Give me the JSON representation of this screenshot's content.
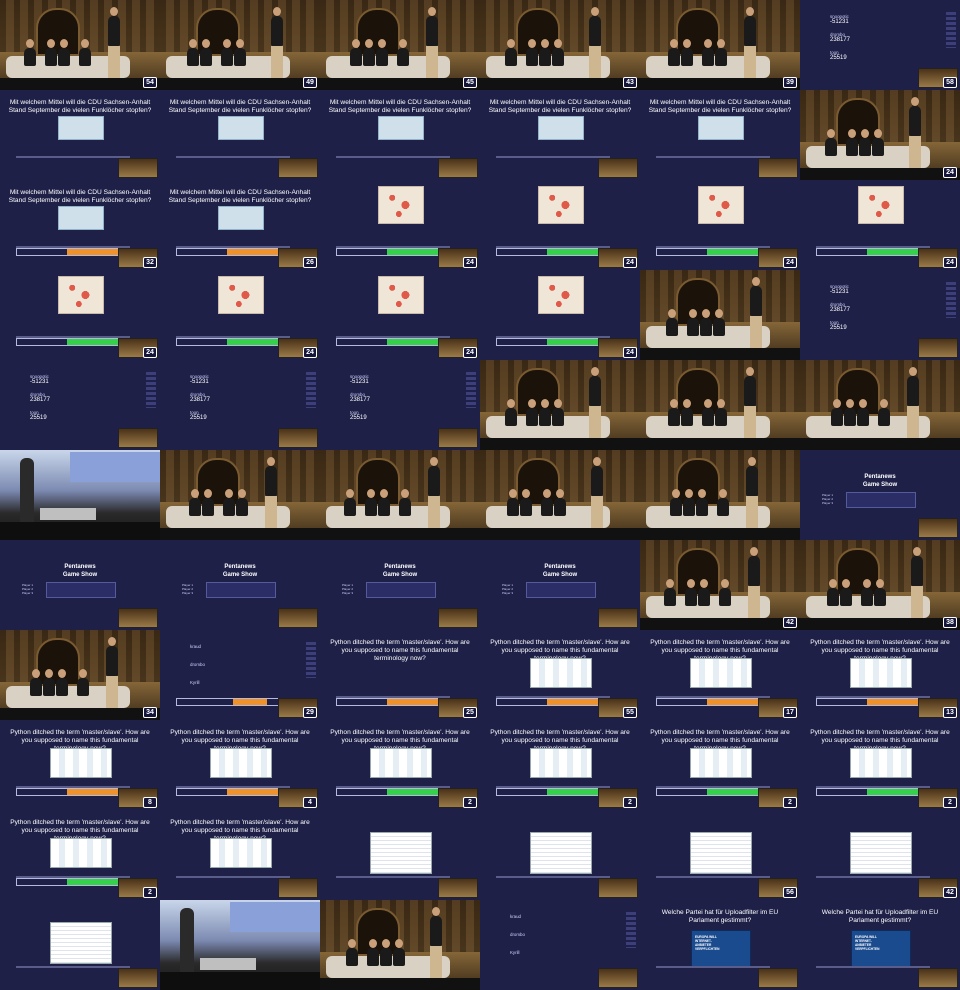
{
  "question_de": "Mit welchem Mittel will die CDU Sachsen-Anhalt Stand September die vielen Funklöcher stopfen?",
  "question_py": "Python ditched the term 'master/slave'. How are you supposed to name this fundamental terminology now?",
  "question_eu": "Welche Partei hat für Uploadfilter im EU Parlament gestimmt?",
  "pentanews_title_1": "Pentanews",
  "pentanews_title_2": "Game Show",
  "players": [
    "Player 1",
    "Player 2",
    "Player 3"
  ],
  "scores_a": [
    {
      "name": "snoopotic",
      "value": "-51231"
    },
    {
      "name": "drombo",
      "value": "238177"
    },
    {
      "name": "toon",
      "value": "25519"
    }
  ],
  "scores_b": [
    {
      "name": "kraud",
      "value": ""
    },
    {
      "name": "drombo",
      "value": ""
    },
    {
      "name": "Kyrill",
      "value": ""
    }
  ],
  "colors": {
    "background": "#1c1d3d",
    "orange": "#f0922a",
    "green": "#35d14a",
    "white": "#ffffff"
  },
  "tiles": [
    {
      "type": "stage",
      "num": "54"
    },
    {
      "type": "stage",
      "num": "49"
    },
    {
      "type": "stage",
      "num": "45"
    },
    {
      "type": "stage",
      "num": "43"
    },
    {
      "type": "stage",
      "num": "39"
    },
    {
      "type": "scores_small",
      "num": "58"
    },
    {
      "type": "slide",
      "q": "de",
      "img": "pic",
      "num": ""
    },
    {
      "type": "slide",
      "q": "de",
      "img": "pic",
      "num": ""
    },
    {
      "type": "slide",
      "q": "de",
      "img": "pic",
      "num": ""
    },
    {
      "type": "slide",
      "q": "de",
      "img": "pic",
      "num": ""
    },
    {
      "type": "slide",
      "q": "de",
      "img": "pic",
      "num": ""
    },
    {
      "type": "stage",
      "num": "24"
    },
    {
      "type": "slide",
      "q": "de",
      "img": "pic",
      "bar": "orange",
      "num": "32"
    },
    {
      "type": "slide",
      "q": "de",
      "img": "pic",
      "bar": "orange",
      "num": "26"
    },
    {
      "type": "slide",
      "q": "",
      "img": "map",
      "bar": "green",
      "num": "24"
    },
    {
      "type": "slide",
      "q": "",
      "img": "map",
      "bar": "green",
      "num": "24"
    },
    {
      "type": "slide",
      "q": "",
      "img": "map",
      "bar": "green",
      "num": "24"
    },
    {
      "type": "slide",
      "q": "",
      "img": "map",
      "bar": "green",
      "num": "24"
    },
    {
      "type": "slide",
      "q": "",
      "img": "map",
      "bar": "green",
      "num": "24"
    },
    {
      "type": "slide",
      "q": "",
      "img": "map",
      "bar": "green",
      "num": "24"
    },
    {
      "type": "slide",
      "q": "",
      "img": "map",
      "bar": "green",
      "num": "24"
    },
    {
      "type": "slide",
      "q": "",
      "img": "map",
      "bar": "green",
      "num": "24"
    },
    {
      "type": "stage",
      "num": ""
    },
    {
      "type": "scores",
      "num": ""
    },
    {
      "type": "scores",
      "num": ""
    },
    {
      "type": "scores",
      "num": ""
    },
    {
      "type": "scores",
      "num": ""
    },
    {
      "type": "stage",
      "num": ""
    },
    {
      "type": "stage",
      "num": ""
    },
    {
      "type": "stage",
      "num": ""
    },
    {
      "type": "hall",
      "num": ""
    },
    {
      "type": "stage",
      "num": ""
    },
    {
      "type": "stage",
      "num": ""
    },
    {
      "type": "stage",
      "num": ""
    },
    {
      "type": "stage",
      "num": ""
    },
    {
      "type": "penta",
      "num": ""
    },
    {
      "type": "penta",
      "num": ""
    },
    {
      "type": "penta",
      "num": ""
    },
    {
      "type": "penta",
      "num": ""
    },
    {
      "type": "penta",
      "num": ""
    },
    {
      "type": "stage",
      "num": "42"
    },
    {
      "type": "stage",
      "num": "38"
    },
    {
      "type": "stage",
      "num": "34"
    },
    {
      "type": "scores_b",
      "bar": "orange",
      "num": "29"
    },
    {
      "type": "slide",
      "q": "py",
      "img": "",
      "bar": "orange",
      "num": "25"
    },
    {
      "type": "slide",
      "q": "py",
      "img": "diag",
      "bar": "orange",
      "num": "55"
    },
    {
      "type": "slide",
      "q": "py",
      "img": "diag",
      "bar": "orange",
      "num": "17"
    },
    {
      "type": "slide",
      "q": "py",
      "img": "diag",
      "bar": "orange",
      "num": "13"
    },
    {
      "type": "slide",
      "q": "py",
      "img": "diag",
      "bar": "orange",
      "num": "8"
    },
    {
      "type": "slide",
      "q": "py",
      "img": "diag",
      "bar": "orange",
      "num": "4"
    },
    {
      "type": "slide",
      "q": "py",
      "img": "diag",
      "bar": "green",
      "num": "2"
    },
    {
      "type": "slide",
      "q": "py",
      "img": "diag",
      "bar": "green",
      "num": "2"
    },
    {
      "type": "slide",
      "q": "py",
      "img": "diag",
      "bar": "green",
      "num": "2"
    },
    {
      "type": "slide",
      "q": "py",
      "img": "diag",
      "bar": "green",
      "num": "2"
    },
    {
      "type": "slide",
      "q": "py",
      "img": "diag",
      "bar": "green",
      "num": "2"
    },
    {
      "type": "slide",
      "q": "py",
      "img": "diag",
      "bar": "",
      "num": ""
    },
    {
      "type": "slide",
      "q": "",
      "img": "doc",
      "bar": "",
      "num": ""
    },
    {
      "type": "slide",
      "q": "",
      "img": "doc",
      "bar": "",
      "num": ""
    },
    {
      "type": "slide",
      "q": "",
      "img": "doc",
      "bar": "",
      "num": "56"
    },
    {
      "type": "slide",
      "q": "",
      "img": "doc",
      "bar": "",
      "num": "42"
    },
    {
      "type": "slide",
      "q": "",
      "img": "doc",
      "bar": "",
      "num": ""
    },
    {
      "type": "hall",
      "num": ""
    },
    {
      "type": "stage",
      "num": ""
    },
    {
      "type": "scores_b",
      "num": ""
    },
    {
      "type": "slide",
      "q": "eu",
      "img": "poster",
      "bar": "",
      "num": ""
    },
    {
      "type": "slide",
      "q": "eu",
      "img": "poster",
      "bar": "",
      "num": ""
    }
  ]
}
